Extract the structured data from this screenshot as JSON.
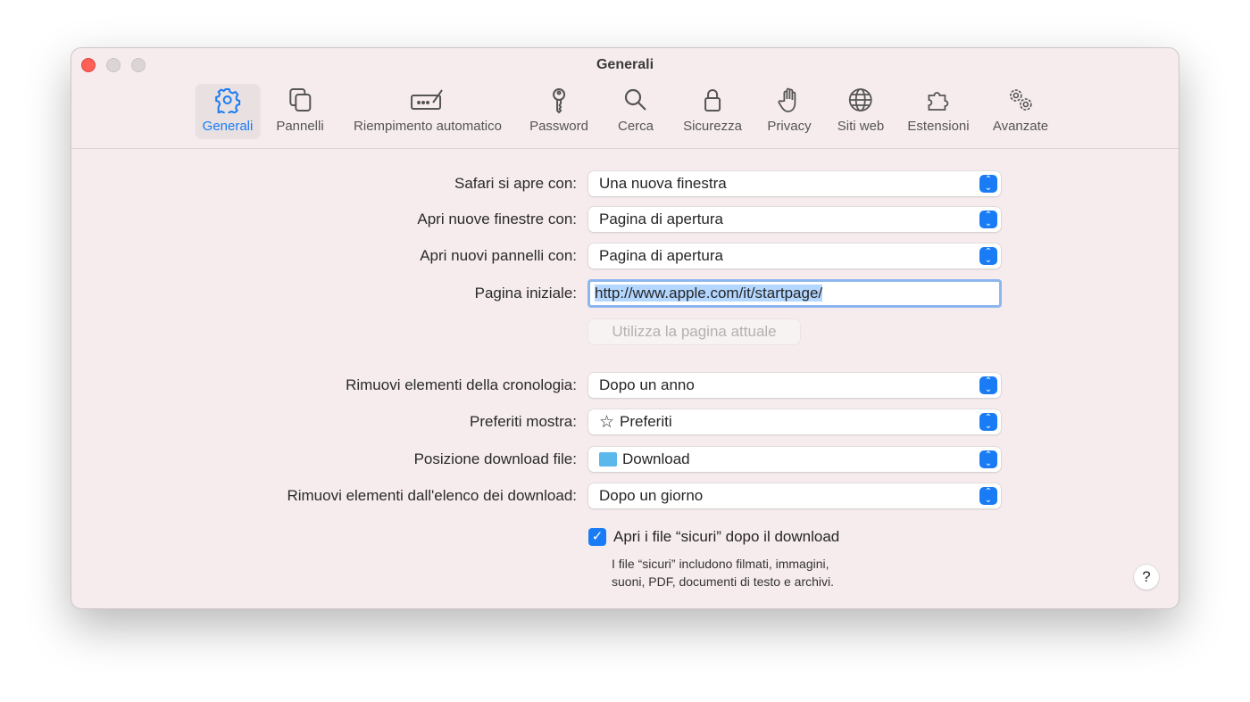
{
  "window": {
    "title": "Generali"
  },
  "toolbar": [
    {
      "label": "Generali",
      "icon": "gear-icon"
    },
    {
      "label": "Pannelli",
      "icon": "tabs-icon"
    },
    {
      "label": "Riempimento automatico",
      "icon": "autofill-icon"
    },
    {
      "label": "Password",
      "icon": "key-icon"
    },
    {
      "label": "Cerca",
      "icon": "search-icon"
    },
    {
      "label": "Sicurezza",
      "icon": "lock-icon"
    },
    {
      "label": "Privacy",
      "icon": "hand-icon"
    },
    {
      "label": "Siti web",
      "icon": "globe-icon"
    },
    {
      "label": "Estensioni",
      "icon": "puzzle-icon"
    },
    {
      "label": "Avanzate",
      "icon": "gears-icon"
    }
  ],
  "form": {
    "opens_with": {
      "label": "Safari si apre con:",
      "value": "Una nuova finestra"
    },
    "new_windows": {
      "label": "Apri nuove finestre con:",
      "value": "Pagina di apertura"
    },
    "new_tabs": {
      "label": "Apri nuovi pannelli con:",
      "value": "Pagina di apertura"
    },
    "homepage": {
      "label": "Pagina iniziale:",
      "value": "http://www.apple.com/it/startpage/"
    },
    "use_current": "Utilizza la pagina attuale",
    "history": {
      "label": "Rimuovi elementi della cronologia:",
      "value": "Dopo un anno"
    },
    "favorites": {
      "label": "Preferiti mostra:",
      "value": "Preferiti"
    },
    "download_loc": {
      "label": "Posizione download file:",
      "value": "Download"
    },
    "download_list": {
      "label": "Rimuovi elementi dall'elenco dei download:",
      "value": "Dopo un giorno"
    },
    "safe_files": {
      "label": "Apri i file “sicuri” dopo il download",
      "checked": true,
      "note1": "I file “sicuri” includono filmati, immagini,",
      "note2": "suoni, PDF, documenti di testo e archivi."
    }
  },
  "help": "?"
}
